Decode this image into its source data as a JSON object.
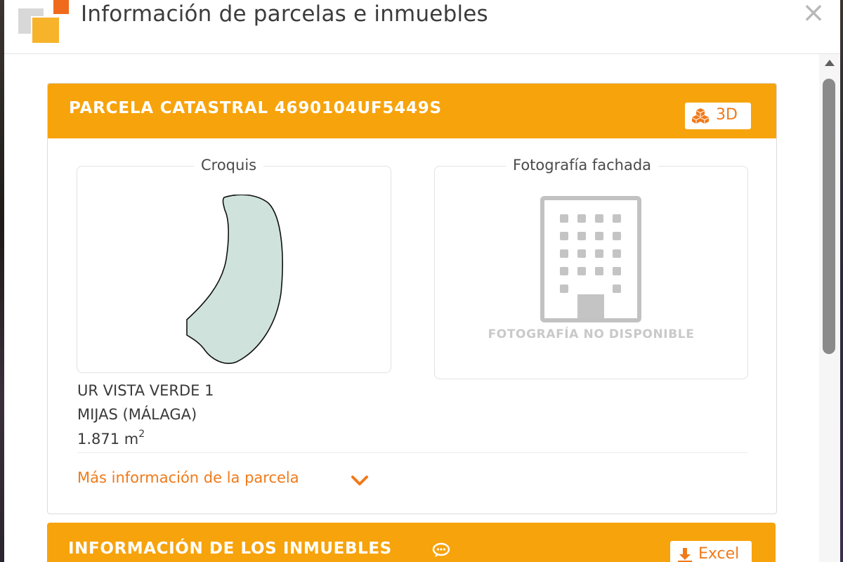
{
  "dialog": {
    "title": "Información de parcelas e inmuebles",
    "close_glyph": "×",
    "logo_icon": "catastro-logo-icon",
    "colors": {
      "accent": "#f7a30c",
      "link": "#f07a1a"
    }
  },
  "parcela": {
    "header": "PARCELA CATASTRAL 4690104UF5449S",
    "btn_3d_label": "3D",
    "croquis_label": "Croquis",
    "foto_label": "Fotografía fachada",
    "no_photo_text": "FOTOGRAFÍA NO DISPONIBLE",
    "address_line1": "UR VISTA VERDE 1",
    "address_line2": "MIJAS (MÁLAGA)",
    "area_value": "1.871 m",
    "area_sup": "2",
    "more_info": "Más información de la parcela"
  },
  "inmuebles": {
    "header": "INFORMACIÓN DE LOS INMUEBLES",
    "excel_label": "Excel"
  }
}
